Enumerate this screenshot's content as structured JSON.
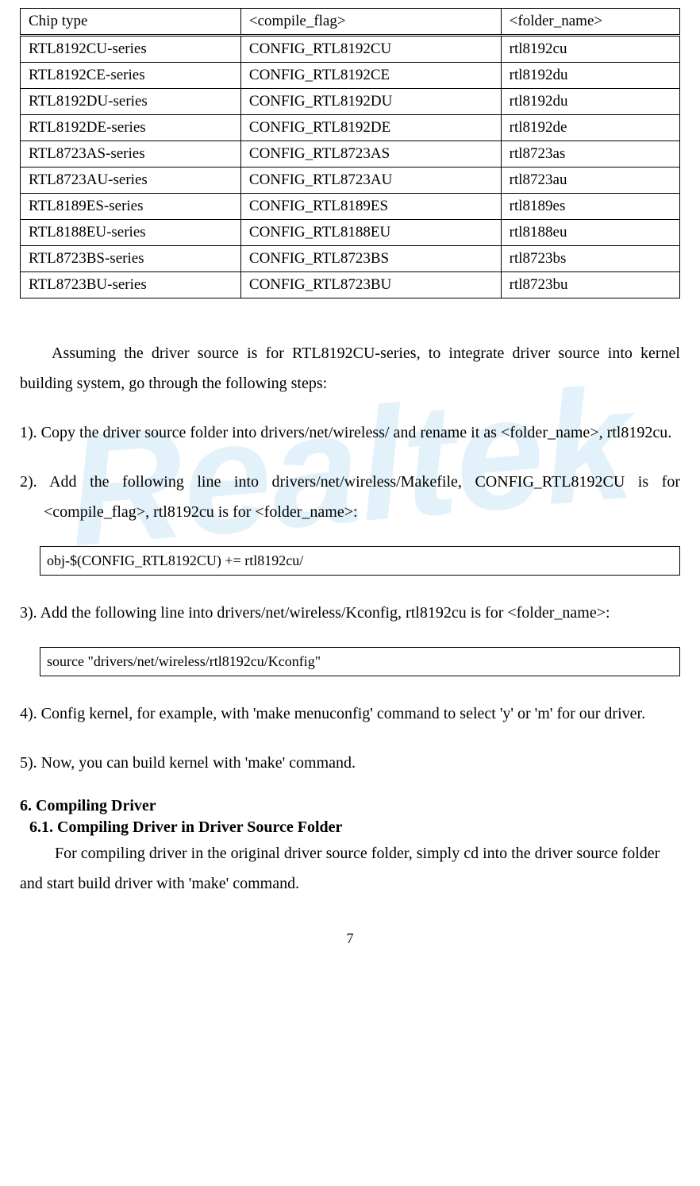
{
  "watermark": "Realtek",
  "table": {
    "headers": [
      "Chip type",
      "<compile_flag>",
      "<folder_name>"
    ],
    "rows": [
      [
        "RTL8192CU-series",
        "CONFIG_RTL8192CU",
        "rtl8192cu"
      ],
      [
        "RTL8192CE-series",
        "CONFIG_RTL8192CE",
        "rtl8192du"
      ],
      [
        "RTL8192DU-series",
        "CONFIG_RTL8192DU",
        "rtl8192du"
      ],
      [
        "RTL8192DE-series",
        "CONFIG_RTL8192DE",
        "rtl8192de"
      ],
      [
        "RTL8723AS-series",
        "CONFIG_RTL8723AS",
        "rtl8723as"
      ],
      [
        "RTL8723AU-series",
        "CONFIG_RTL8723AU",
        "rtl8723au"
      ],
      [
        "RTL8189ES-series",
        "CONFIG_RTL8189ES",
        "rtl8189es"
      ],
      [
        "RTL8188EU-series",
        "CONFIG_RTL8188EU",
        "rtl8188eu"
      ],
      [
        "RTL8723BS-series",
        "CONFIG_RTL8723BS",
        "rtl8723bs"
      ],
      [
        "RTL8723BU-series",
        "CONFIG_RTL8723BU",
        "rtl8723bu"
      ]
    ]
  },
  "intro": "Assuming the driver source is for RTL8192CU-series, to integrate driver source into kernel building system, go through the following steps:",
  "step1": {
    "marker": "1).",
    "text": "Copy the driver source folder into drivers/net/wireless/ and rename it as <folder_name>, rtl8192cu."
  },
  "step2": {
    "marker": "2).",
    "text": "Add the following line into drivers/net/wireless/Makefile, CONFIG_RTL8192CU is for <compile_flag>, rtl8192cu is for <folder_name>:",
    "code": "obj-$(CONFIG_RTL8192CU)    += rtl8192cu/"
  },
  "step3": {
    "marker": "3).",
    "text": "Add the following line into drivers/net/wireless/Kconfig, rtl8192cu is for <folder_name>:",
    "code": "source \"drivers/net/wireless/rtl8192cu/Kconfig\""
  },
  "step4": {
    "marker": "4).",
    "text": "Config kernel, for example, with 'make menuconfig' command to select 'y' or 'm' for our driver."
  },
  "step5": {
    "marker": "5).",
    "text": "Now, you can build kernel with 'make' command."
  },
  "section6": {
    "heading": "6.    Compiling Driver",
    "subheading": "6.1.   Compiling Driver in Driver Source Folder",
    "body": "For compiling driver in the original driver source folder, simply cd into the driver source folder and start build driver with 'make' command."
  },
  "page_number": "7"
}
